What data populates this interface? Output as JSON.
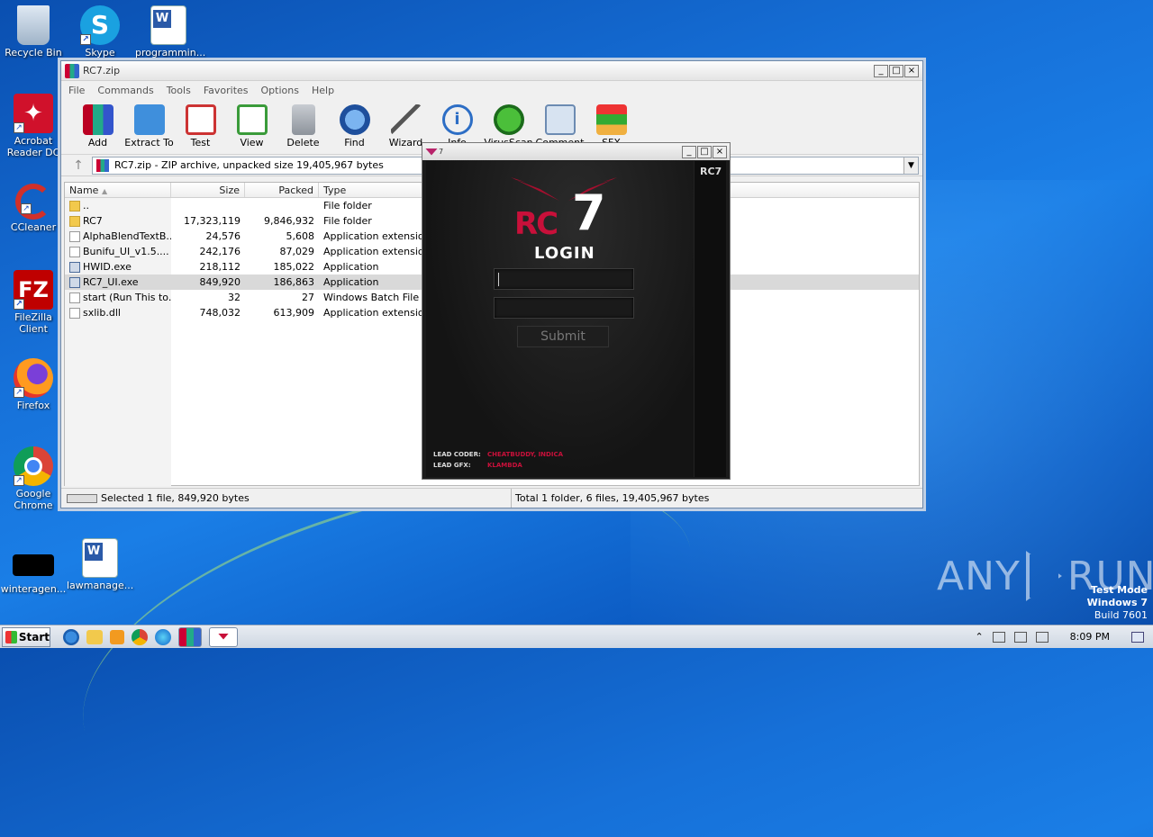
{
  "desktop": {
    "icons": [
      {
        "label": "Recycle Bin"
      },
      {
        "label": "Skype"
      },
      {
        "label": "programmin..."
      },
      {
        "label": "Acrobat Reader DC"
      },
      {
        "label": "CCleaner"
      },
      {
        "label": "FileZilla Client"
      },
      {
        "label": "Firefox"
      },
      {
        "label": "Google Chrome"
      },
      {
        "label": "winteragen..."
      },
      {
        "label": "lawmanage..."
      }
    ]
  },
  "winrar": {
    "title": "RC7.zip",
    "menu": [
      "File",
      "Commands",
      "Tools",
      "Favorites",
      "Options",
      "Help"
    ],
    "toolbar": [
      "Add",
      "Extract To",
      "Test",
      "View",
      "Delete",
      "Find",
      "Wizard",
      "Info",
      "VirusScan",
      "Comment",
      "SFX"
    ],
    "address": "RC7.zip - ZIP archive, unpacked size 19,405,967 bytes",
    "columns": {
      "name": "Name",
      "size": "Size",
      "packed": "Packed",
      "type": "Type"
    },
    "files": [
      {
        "name": "..",
        "size": "",
        "packed": "",
        "type": "File folder",
        "kind": "folder"
      },
      {
        "name": "RC7",
        "size": "17,323,119",
        "packed": "9,846,932",
        "type": "File folder",
        "kind": "folder"
      },
      {
        "name": "AlphaBlendTextB...",
        "size": "24,576",
        "packed": "5,608",
        "type": "Application extension",
        "kind": "dll"
      },
      {
        "name": "Bunifu_UI_v1.5....",
        "size": "242,176",
        "packed": "87,029",
        "type": "Application extension",
        "kind": "dll"
      },
      {
        "name": "HWID.exe",
        "size": "218,112",
        "packed": "185,022",
        "type": "Application",
        "kind": "app"
      },
      {
        "name": "RC7_UI.exe",
        "size": "849,920",
        "packed": "186,863",
        "type": "Application",
        "kind": "app"
      },
      {
        "name": "start (Run This to...",
        "size": "32",
        "packed": "27",
        "type": "Windows Batch File",
        "kind": "bat"
      },
      {
        "name": "sxlib.dll",
        "size": "748,032",
        "packed": "613,909",
        "type": "Application extension",
        "kind": "dll"
      }
    ],
    "status_left": "Selected 1 file, 849,920 bytes",
    "status_right": "Total 1 folder, 6 files, 19,405,967 bytes"
  },
  "rc7": {
    "title_mini": "7",
    "logo_rc": "RC",
    "logo_seven": "7",
    "logo_login": "LOGIN",
    "side_logo": "RC7",
    "submit": "Submit",
    "credit1_key": "LEAD CODER:",
    "credit1_val": "CHEATBUDDY, INDICA",
    "credit2_key": "LEAD GFX:",
    "credit2_val": "KLAMBDA"
  },
  "watermark": {
    "any": "ANY",
    "run": "RUN"
  },
  "testmode": {
    "line1": "Test Mode",
    "line2": "Windows 7",
    "line3": "Build 7601"
  },
  "taskbar": {
    "start": "Start",
    "clock": "8:09 PM"
  }
}
